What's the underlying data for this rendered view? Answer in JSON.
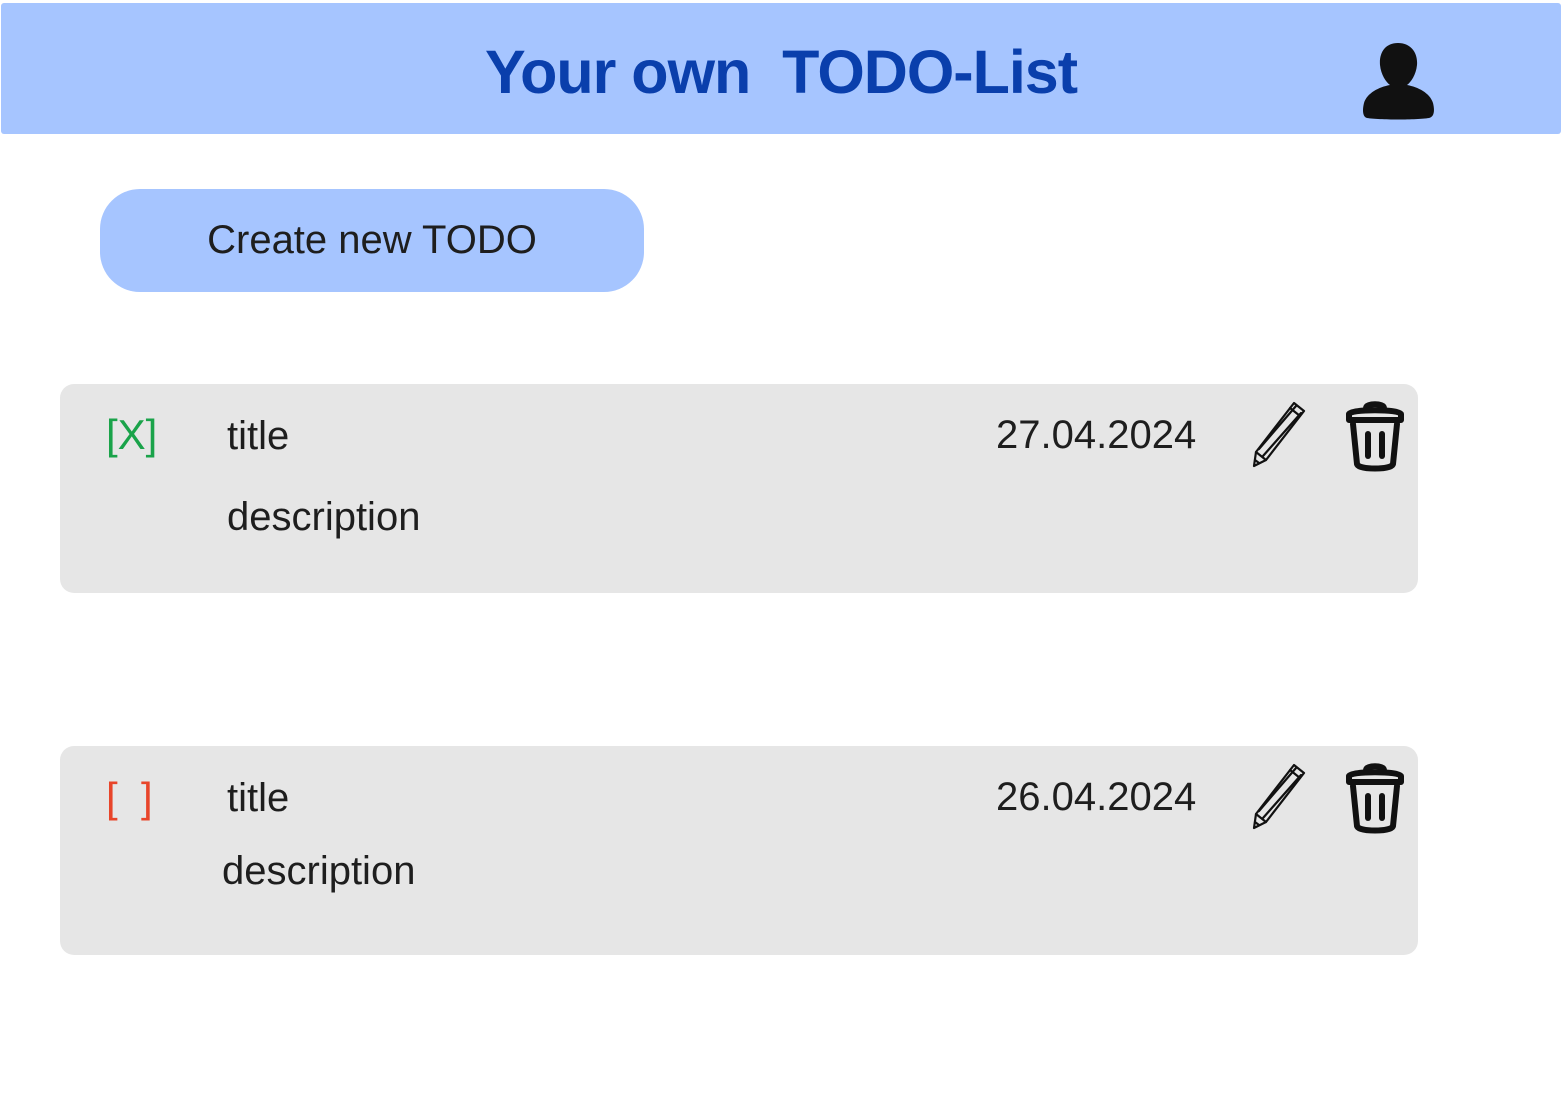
{
  "header": {
    "title": "Your own  TODO-List",
    "avatar_icon": "user-icon"
  },
  "actions": {
    "create_label": "Create new TODO"
  },
  "todos": [
    {
      "checkbox": "[X]",
      "status": "done",
      "title": "title",
      "description": "description",
      "date": "27.04.2024",
      "edit_icon": "pencil-icon",
      "delete_icon": "trash-icon"
    },
    {
      "checkbox": "[  ]",
      "status": "open",
      "title": "title",
      "description": "description",
      "date": "26.04.2024",
      "edit_icon": "pencil-icon",
      "delete_icon": "trash-icon"
    }
  ],
  "colors": {
    "header_bg": "#a6c5ff",
    "title_color": "#0a3fac",
    "card_bg": "#e6e6e6",
    "done_color": "#1aa34a",
    "open_color": "#e8452a"
  }
}
